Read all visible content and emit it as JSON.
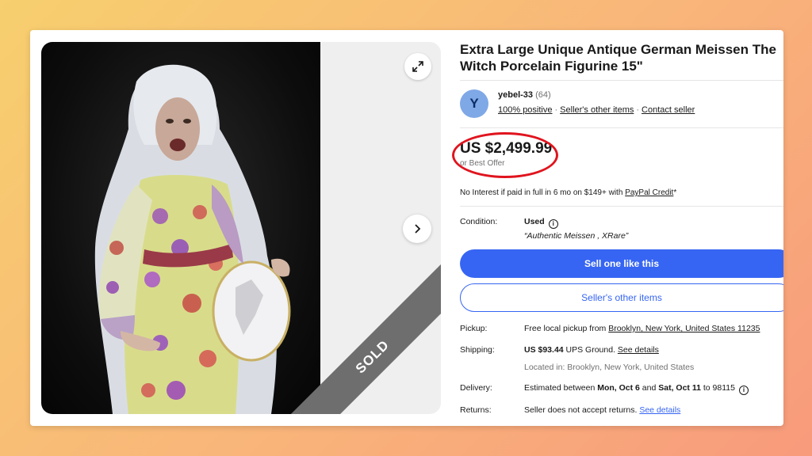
{
  "listing": {
    "title": "Extra Large Unique Antique German Meissen The Witch Porcelain Figurine 15\"",
    "sold_label": "SOLD",
    "expand_icon": "expand-arrows-icon",
    "next_icon": "chevron-right-icon"
  },
  "seller": {
    "avatar_letter": "Y",
    "name": "yebel-33",
    "feedback_count": "(64)",
    "positive": "100% positive",
    "other_items": "Seller's other items",
    "contact": "Contact seller"
  },
  "price": {
    "amount": "US $2,499.99",
    "best_offer": "or Best Offer",
    "credit_text": "No Interest if paid in full in 6 mo on $149+ with ",
    "credit_link": "PayPal Credit",
    "credit_suffix": "*"
  },
  "condition": {
    "label": "Condition:",
    "value": "Used",
    "note": "“Authentic Meissen , XRare”"
  },
  "buttons": {
    "sell_one": "Sell one like this",
    "seller_items": "Seller's other items"
  },
  "pickup": {
    "label": "Pickup:",
    "text": "Free local pickup from ",
    "location": "Brooklyn, New York, United States 11235"
  },
  "shipping": {
    "label": "Shipping:",
    "cost": "US $93.44",
    "method": " UPS Ground. ",
    "details_link": "See details",
    "located": "Located in: Brooklyn, New York, United States"
  },
  "delivery": {
    "label": "Delivery:",
    "prefix": "Estimated between ",
    "start": "Mon, Oct 6",
    "and": " and ",
    "end": "Sat, Oct 11",
    "suffix": " to 98115"
  },
  "returns": {
    "label": "Returns:",
    "text": "Seller does not accept returns. ",
    "details_link": "See details"
  },
  "colors": {
    "accent_blue": "#3665f3",
    "highlight_red": "#e0141e",
    "sold_gray": "#6e6e6e"
  }
}
